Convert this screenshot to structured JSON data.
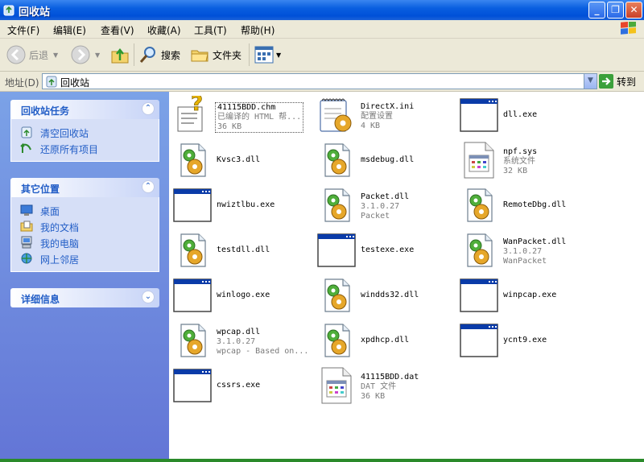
{
  "window": {
    "title": "回收站",
    "controls": [
      "minimize-icon",
      "maximize-icon",
      "close-icon"
    ]
  },
  "menu": [
    "文件(F)",
    "编辑(E)",
    "查看(V)",
    "收藏(A)",
    "工具(T)",
    "帮助(H)"
  ],
  "toolbar": {
    "back": "后退",
    "search": "搜索",
    "folders": "文件夹"
  },
  "address": {
    "label": "地址(D)",
    "value": "回收站",
    "go": "转到"
  },
  "tasks_panel": {
    "title": "回收站任务",
    "items": [
      {
        "label": "清空回收站",
        "icon": "empty-bin-icon"
      },
      {
        "label": "还原所有项目",
        "icon": "restore-icon"
      }
    ]
  },
  "places_panel": {
    "title": "其它位置",
    "items": [
      {
        "label": "桌面",
        "icon": "desktop-icon"
      },
      {
        "label": "我的文档",
        "icon": "my-documents-icon"
      },
      {
        "label": "我的电脑",
        "icon": "my-computer-icon"
      },
      {
        "label": "网上邻居",
        "icon": "network-icon"
      }
    ]
  },
  "details_panel": {
    "title": "详细信息"
  },
  "files": [
    {
      "name": "41115BDD.chm",
      "line2": "已编译的 HTML 帮...",
      "line3": "36 KB",
      "icon": "chm-help-icon"
    },
    {
      "name": "DirectX.ini",
      "line2": "配置设置",
      "line3": "4 KB",
      "icon": "ini-config-icon"
    },
    {
      "name": "dll.exe",
      "line2": "",
      "line3": "",
      "icon": "exe-window-icon"
    },
    {
      "name": "Kvsc3.dll",
      "line2": "",
      "line3": "",
      "icon": "dll-gear-icon"
    },
    {
      "name": "msdebug.dll",
      "line2": "",
      "line3": "",
      "icon": "dll-gear-icon"
    },
    {
      "name": "npf.sys",
      "line2": "系统文件",
      "line3": "32 KB",
      "icon": "sys-file-icon"
    },
    {
      "name": "nwiztlbu.exe",
      "line2": "",
      "line3": "",
      "icon": "exe-window-icon"
    },
    {
      "name": "Packet.dll",
      "line2": "3.1.0.27",
      "line3": "Packet",
      "icon": "dll-gear-icon"
    },
    {
      "name": "RemoteDbg.dll",
      "line2": "",
      "line3": "",
      "icon": "dll-gear-icon"
    },
    {
      "name": "testdll.dll",
      "line2": "",
      "line3": "",
      "icon": "dll-gear-icon"
    },
    {
      "name": "testexe.exe",
      "line2": "",
      "line3": "",
      "icon": "exe-window-icon"
    },
    {
      "name": "WanPacket.dll",
      "line2": "3.1.0.27",
      "line3": "WanPacket",
      "icon": "dll-gear-icon"
    },
    {
      "name": "winlogo.exe",
      "line2": "",
      "line3": "",
      "icon": "exe-window-icon"
    },
    {
      "name": "windds32.dll",
      "line2": "",
      "line3": "",
      "icon": "dll-gear-icon"
    },
    {
      "name": "winpcap.exe",
      "line2": "",
      "line3": "",
      "icon": "exe-window-icon"
    },
    {
      "name": "wpcap.dll",
      "line2": "3.1.0.27",
      "line3": "wpcap - Based on...",
      "icon": "dll-gear-icon"
    },
    {
      "name": "xpdhcp.dll",
      "line2": "",
      "line3": "",
      "icon": "dll-gear-icon"
    },
    {
      "name": "ycnt9.exe",
      "line2": "",
      "line3": "",
      "icon": "exe-window-icon"
    },
    {
      "name": "cssrs.exe",
      "line2": "",
      "line3": "",
      "icon": "exe-window-icon"
    },
    {
      "name": "41115BDD.dat",
      "line2": "DAT 文件",
      "line3": "36 KB",
      "icon": "dat-file-icon"
    }
  ],
  "colors": {
    "titlebar": "#0a5fe0",
    "leftpane": "#7ba2e7",
    "link": "#215dc6",
    "menubar": "#ece9d8"
  }
}
